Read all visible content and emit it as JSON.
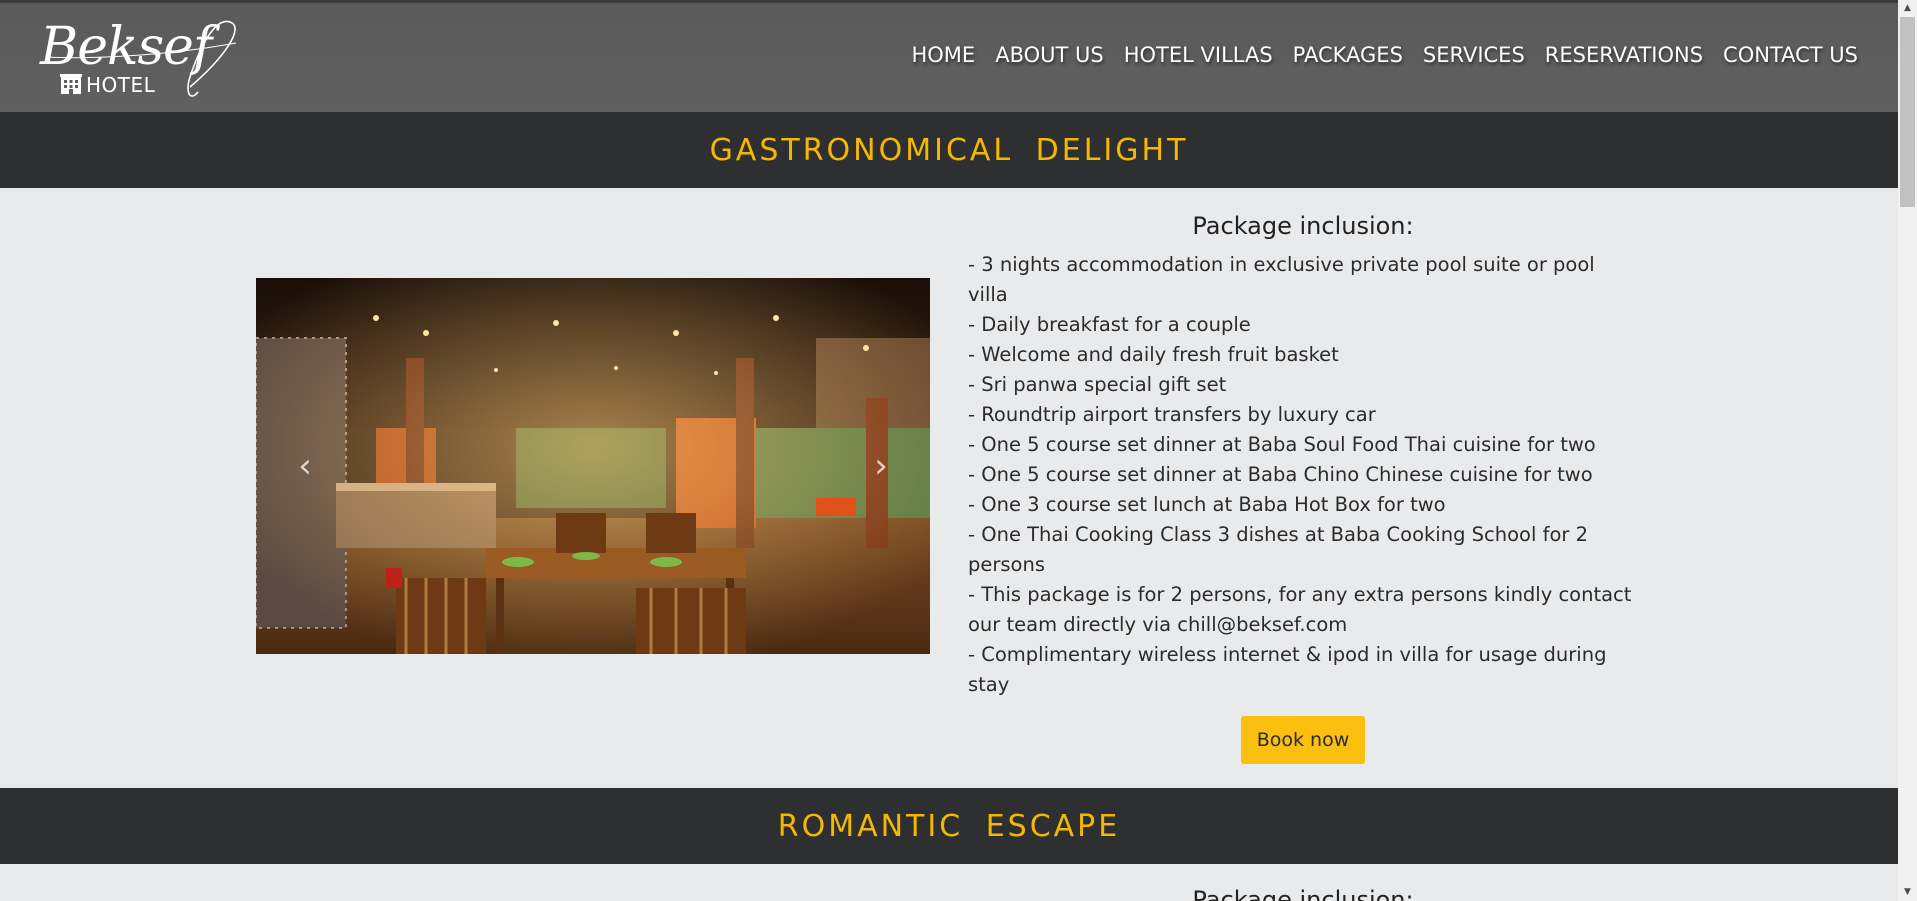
{
  "brand": {
    "name_script": "Beksef",
    "name_sub": "HOTEL"
  },
  "nav": {
    "items": [
      {
        "label": "HOME"
      },
      {
        "label": "ABOUT US"
      },
      {
        "label": "HOTEL VILLAS"
      },
      {
        "label": "PACKAGES"
      },
      {
        "label": "SERVICES"
      },
      {
        "label": "RESERVATIONS"
      },
      {
        "label": "CONTACT US"
      }
    ]
  },
  "packages": [
    {
      "title": "GASTRONOMICAL DELIGHT",
      "inclusion_heading": "Package inclusion:",
      "items": [
        "- 3 nights accommodation in exclusive private pool suite or pool villa",
        "- Daily breakfast for a couple",
        "- Welcome and daily fresh fruit basket",
        "- Sri panwa special gift set",
        "- Roundtrip airport transfers by luxury car",
        "- One 5 course set dinner at Baba Soul Food Thai cuisine for two",
        "- One 5 course set dinner at Baba Chino Chinese cuisine for two",
        "- One 3 course set lunch at Baba Hot Box for two",
        "- One Thai Cooking Class 3 dishes at Baba Cooking School for 2 persons",
        "- This package is for 2 persons, for any extra persons kindly contact our team directly via chill@beksef.com",
        "- Complimentary wireless internet & ipod in villa for usage during stay"
      ],
      "book_label": "Book now",
      "carousel": {
        "prev_icon": "‹",
        "next_icon": "›"
      }
    },
    {
      "title": "ROMANTIC ESCAPE",
      "inclusion_heading": "Package inclusion:"
    }
  ],
  "colors": {
    "accent": "#f5b800",
    "button": "#fbbf10",
    "section_bar": "#2e2f31",
    "header": "#5e5e5e"
  }
}
